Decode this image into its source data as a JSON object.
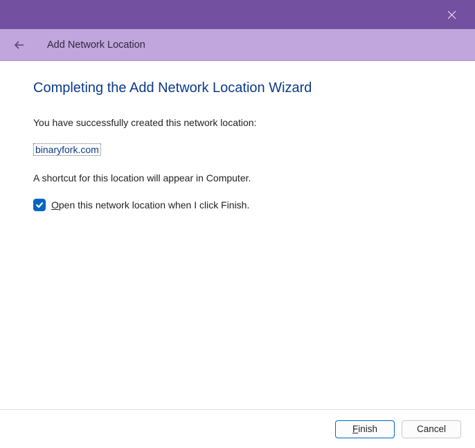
{
  "header": {
    "title": "Add Network Location"
  },
  "wizard": {
    "title": "Completing the Add Network Location Wizard",
    "successText": "You have successfully created this network location:",
    "locationName": "binaryfork.com",
    "shortcutText": "A shortcut for this location will appear in Computer.",
    "checkboxAccessKey": "O",
    "checkboxRest": "pen this network location when I click Finish.",
    "checkboxChecked": true
  },
  "buttons": {
    "finishAccessKey": "F",
    "finishRest": "inish",
    "cancel": "Cancel"
  }
}
